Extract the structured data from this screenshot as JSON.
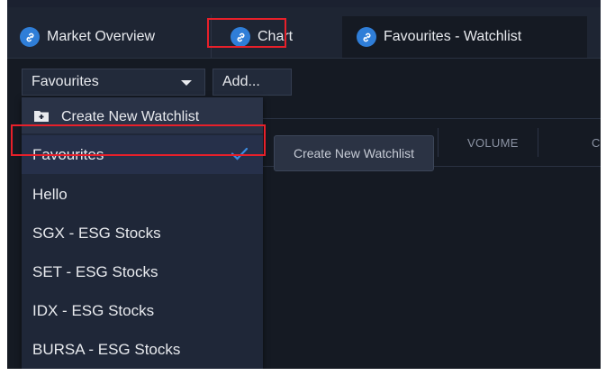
{
  "tabs": [
    {
      "label": "Market Overview",
      "icon": "link-icon"
    },
    {
      "label": "Chart",
      "icon": "link-icon"
    },
    {
      "label": "Favourites - Watchlist",
      "icon": "link-icon"
    }
  ],
  "toolbar": {
    "watchlist_select": "Favourites",
    "add_label": "Add..."
  },
  "table": {
    "columns": [
      "VOLUME",
      "C"
    ]
  },
  "tooltip": {
    "text": "Create New Watchlist"
  },
  "dropdown": {
    "create_label": "Create New Watchlist",
    "items": [
      {
        "label": "Favourites"
      },
      {
        "label": "Hello"
      },
      {
        "label": "SGX - ESG Stocks"
      },
      {
        "label": "SET - ESG Stocks"
      },
      {
        "label": "IDX - ESG Stocks"
      },
      {
        "label": "BURSA - ESG Stocks"
      }
    ],
    "selected_index": 0
  },
  "colors": {
    "background": "#151a23",
    "accent_blue": "#2f7ed8",
    "highlight_red": "#e8202a"
  }
}
